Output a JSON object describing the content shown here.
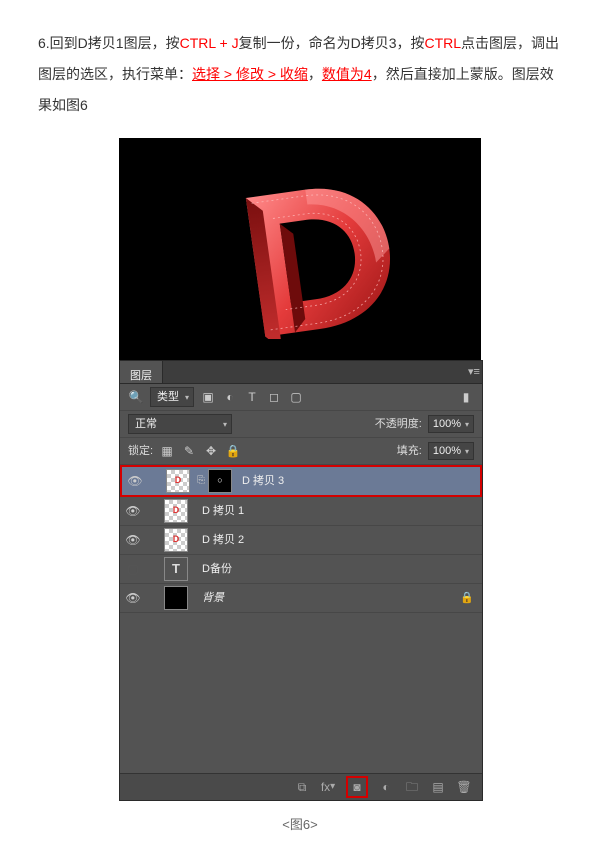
{
  "step_text": {
    "prefix": "6.回到D拷贝1图层，按",
    "ctrlj": "CTRL + J",
    "after_ctrlj": "复制一份，命名为D拷贝3，按",
    "ctrl": "CTRL",
    "after_ctrl": "点击图层，调出图层的选区，执行菜单：",
    "menu_path": "选择 > 修改 > 收缩",
    "comma": "，",
    "value_text": "数值为4",
    "tail": "，然后直接加上蒙版。图层效果如图6"
  },
  "panel": {
    "tab": "图层",
    "filter_kind": "类型",
    "blend_mode": "正常",
    "opacity_label": "不透明度:",
    "opacity_value": "100%",
    "lock_label": "锁定:",
    "fill_label": "填充:",
    "fill_value": "100%"
  },
  "layers": [
    {
      "name": "D 拷贝 3",
      "visible": true,
      "selected": true,
      "thumb": "d",
      "hasMask": true
    },
    {
      "name": "D 拷贝 1",
      "visible": true,
      "selected": false,
      "thumb": "d"
    },
    {
      "name": "D 拷贝 2",
      "visible": true,
      "selected": false,
      "thumb": "d"
    },
    {
      "name": "D备份",
      "visible": false,
      "selected": false,
      "thumb": "T"
    },
    {
      "name": "背景",
      "visible": true,
      "selected": false,
      "thumb": "black",
      "locked": true,
      "italic": true
    }
  ],
  "caption": "<图6>"
}
